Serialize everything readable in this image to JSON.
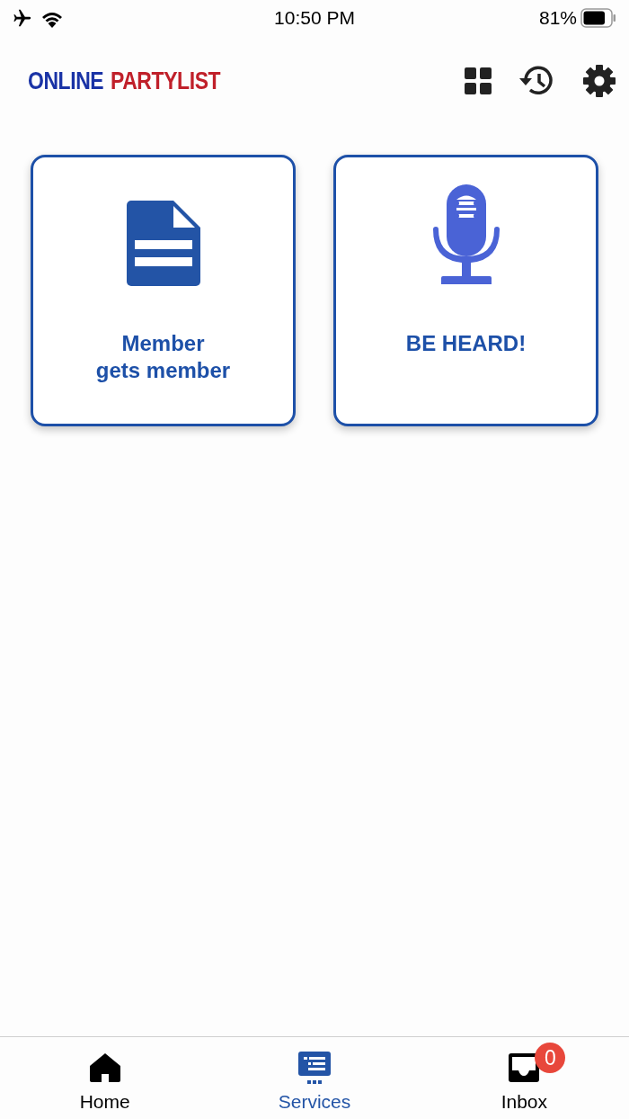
{
  "status_bar": {
    "time": "10:50 PM",
    "battery": "81%"
  },
  "header": {
    "logo": [
      {
        "text": "ONLINE",
        "color": "#1a33a6"
      },
      {
        "text": "PARTYLIST",
        "color": "#c0202a"
      }
    ],
    "actions": [
      {
        "kind": "grid"
      },
      {
        "kind": "history"
      },
      {
        "kind": "settings"
      }
    ]
  },
  "cards": [
    {
      "kind": "document",
      "label": "Member\ngets member"
    },
    {
      "kind": "microphone",
      "label": "BE HEARD!"
    }
  ],
  "tab_bar": [
    {
      "kind": "home",
      "label": "Home",
      "selected": false
    },
    {
      "kind": "services",
      "label": "Services",
      "selected": true
    },
    {
      "kind": "inbox",
      "label": "Inbox",
      "selected": false,
      "badge": "0"
    }
  ]
}
